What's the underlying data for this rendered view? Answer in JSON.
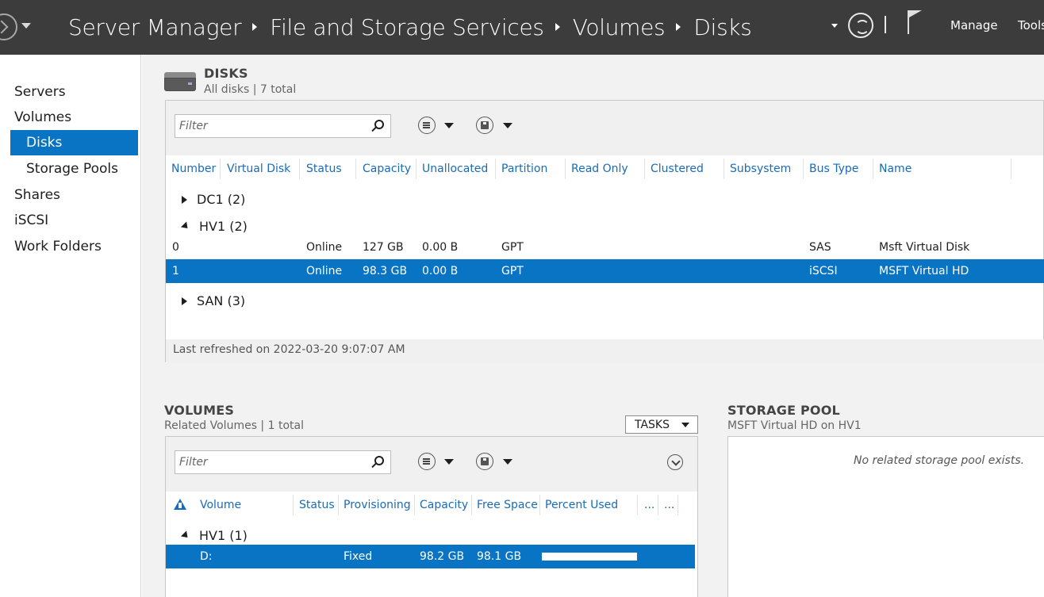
{
  "titlebar": {
    "breadcrumb": [
      "Server Manager",
      "File and Storage Services",
      "Volumes",
      "Disks"
    ],
    "menu_manage": "Manage",
    "menu_tools": "Tools"
  },
  "sidebar": {
    "items": [
      {
        "label": "Servers"
      },
      {
        "label": "Volumes"
      },
      {
        "label": "Disks"
      },
      {
        "label": "Storage Pools"
      },
      {
        "label": "Shares"
      },
      {
        "label": "iSCSI"
      },
      {
        "label": "Work Folders"
      }
    ]
  },
  "disks": {
    "title": "DISKS",
    "subtitle": "All disks | 7 total",
    "filter_placeholder": "Filter",
    "columns": [
      "Number",
      "Virtual Disk",
      "Status",
      "Capacity",
      "Unallocated",
      "Partition",
      "Read Only",
      "Clustered",
      "Subsystem",
      "Bus Type",
      "Name"
    ],
    "groups": [
      {
        "label": "DC1 (2)"
      },
      {
        "label": "HV1 (2)"
      },
      {
        "label": "SAN (3)"
      }
    ],
    "rows": [
      {
        "number": "0",
        "status": "Online",
        "capacity": "127 GB",
        "unallocated": "0.00 B",
        "partition": "GPT",
        "bus_type": "SAS",
        "name": "Msft Virtual Disk"
      },
      {
        "number": "1",
        "status": "Online",
        "capacity": "98.3 GB",
        "unallocated": "0.00 B",
        "partition": "GPT",
        "bus_type": "iSCSI",
        "name": "MSFT Virtual HD"
      }
    ],
    "last_refreshed": "Last refreshed on 2022-03-20 9:07:07 AM"
  },
  "volumes": {
    "title": "VOLUMES",
    "subtitle": "Related Volumes | 1 total",
    "tasks_label": "TASKS",
    "filter_placeholder": "Filter",
    "columns": [
      "Volume",
      "Status",
      "Provisioning",
      "Capacity",
      "Free Space",
      "Percent Used",
      "...",
      "..."
    ],
    "groups": [
      {
        "label": "HV1 (1)"
      }
    ],
    "rows": [
      {
        "volume": "D:",
        "provisioning": "Fixed",
        "capacity": "98.2 GB",
        "free_space": "98.1 GB",
        "percent_used": 0.1
      }
    ]
  },
  "storage_pool": {
    "title": "STORAGE POOL",
    "subtitle": "MSFT Virtual HD on HV1",
    "empty_message": "No related storage pool exists."
  },
  "colors": {
    "titlebar_bg": "#3c3c3c",
    "selection": "#0a74c4",
    "column_header": "#1a6bb8"
  }
}
